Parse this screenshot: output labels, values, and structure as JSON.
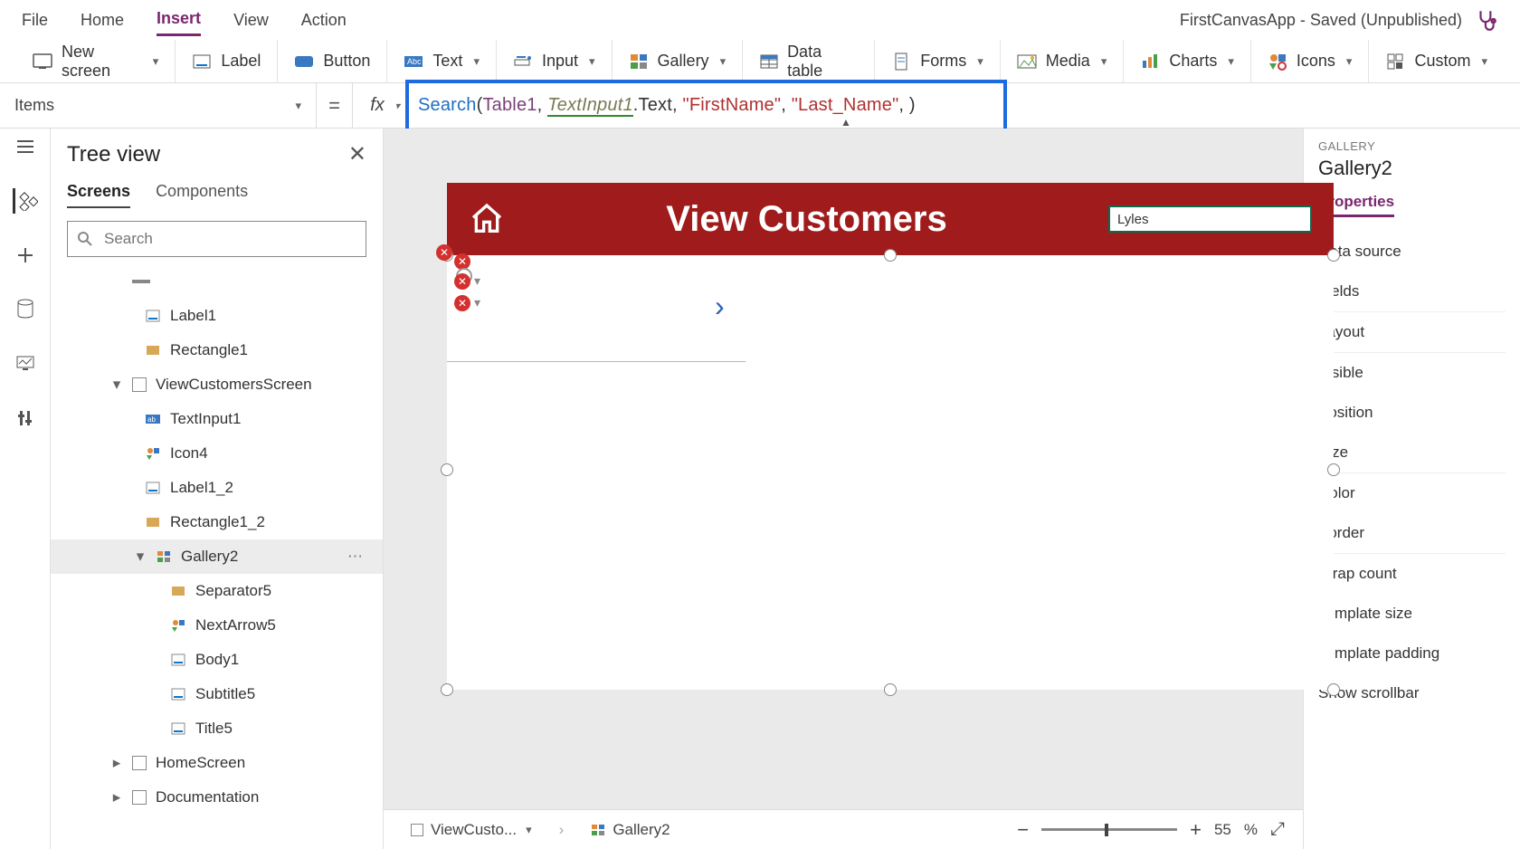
{
  "app_title": "FirstCanvasApp - Saved (Unpublished)",
  "menu": {
    "file": "File",
    "home": "Home",
    "insert": "Insert",
    "view": "View",
    "action": "Action"
  },
  "ribbon": {
    "new_screen": "New screen",
    "label": "Label",
    "button": "Button",
    "text": "Text",
    "input": "Input",
    "gallery": "Gallery",
    "data_table": "Data table",
    "forms": "Forms",
    "media": "Media",
    "charts": "Charts",
    "icons": "Icons",
    "custom": "Custom"
  },
  "property_selector": "Items",
  "formula": {
    "fn": "Search",
    "open": "(",
    "table": "Table1",
    "c1": ", ",
    "text_input": "TextInput1",
    "dot_text": ".Text",
    "c2": ", ",
    "col1": "\"FirstName\"",
    "c3": ", ",
    "col2": "\"Last_Name\"",
    "c4": ", ",
    "close": ")"
  },
  "tree": {
    "title": "Tree view",
    "tab_screens": "Screens",
    "tab_components": "Components",
    "search_placeholder": "Search",
    "items": {
      "label1": "Label1",
      "rectangle1": "Rectangle1",
      "view_customers": "ViewCustomersScreen",
      "textinput1": "TextInput1",
      "icon4": "Icon4",
      "label1_2": "Label1_2",
      "rectangle1_2": "Rectangle1_2",
      "gallery2": "Gallery2",
      "separator5": "Separator5",
      "nextarrow5": "NextArrow5",
      "body1": "Body1",
      "subtitle5": "Subtitle5",
      "title5": "Title5",
      "homescreen": "HomeScreen",
      "documentation": "Documentation"
    }
  },
  "canvas": {
    "title": "View Customers",
    "search_value": "Lyles"
  },
  "breadcrumb": {
    "screen": "ViewCusto...",
    "control": "Gallery2"
  },
  "zoom": {
    "value": "55",
    "pct": "%"
  },
  "right": {
    "kind": "GALLERY",
    "name": "Gallery2",
    "tab": "Properties",
    "rows": {
      "data_source": "Data source",
      "fields": "Fields",
      "layout": "Layout",
      "visible": "Visible",
      "position": "Position",
      "size": "Size",
      "color": "Color",
      "border": "Border",
      "wrap_count": "Wrap count",
      "template_size": "Template size",
      "template_padding": "Template padding",
      "scrollbar": "Show scrollbar"
    }
  }
}
